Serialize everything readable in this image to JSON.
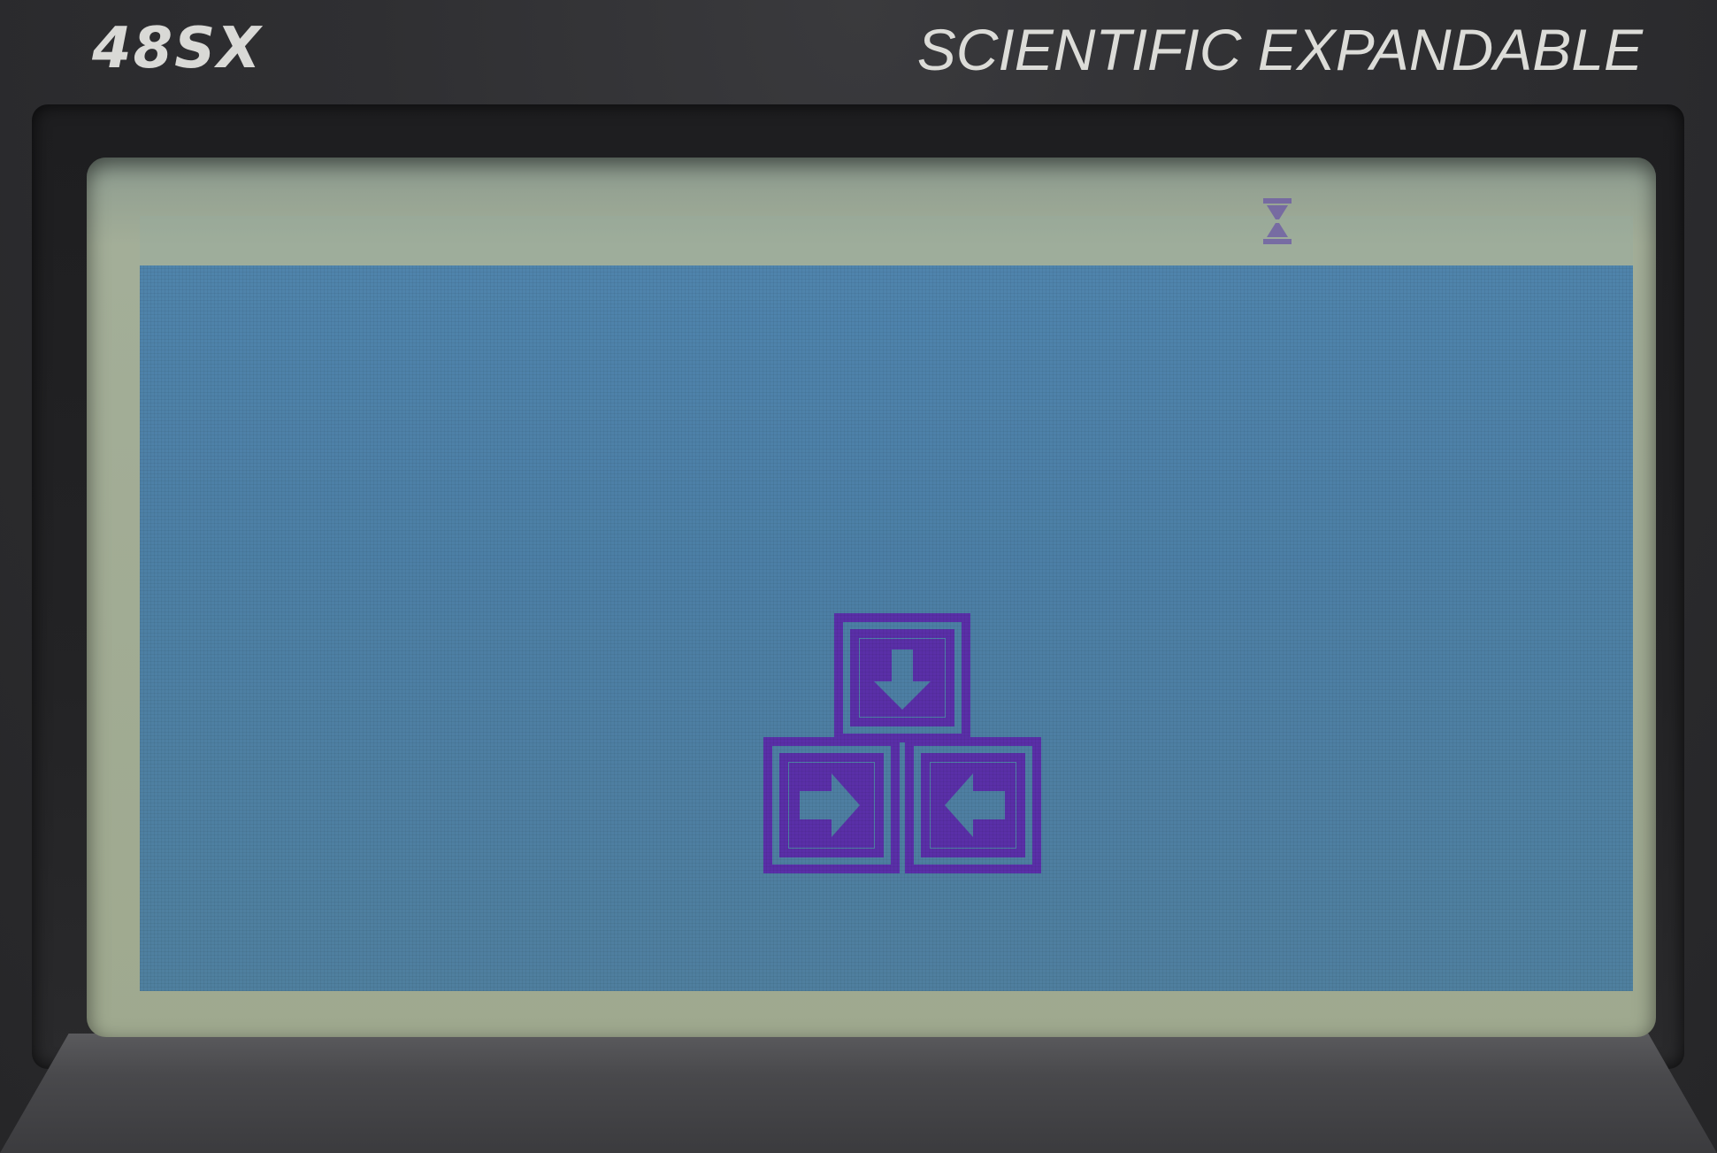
{
  "device": {
    "model_label": "48SX",
    "tagline": "SCIENTIFIC EXPANDABLE"
  },
  "screen": {
    "status_indicator_icon": "hourglass-busy-icon",
    "center_graphic_icon": "three-arrow-boxes-logo-icon",
    "colors": {
      "lcd_background": "#4f84ad",
      "pixel_ink": "#5a2fa8",
      "status_bar": "#a3ae98"
    }
  }
}
